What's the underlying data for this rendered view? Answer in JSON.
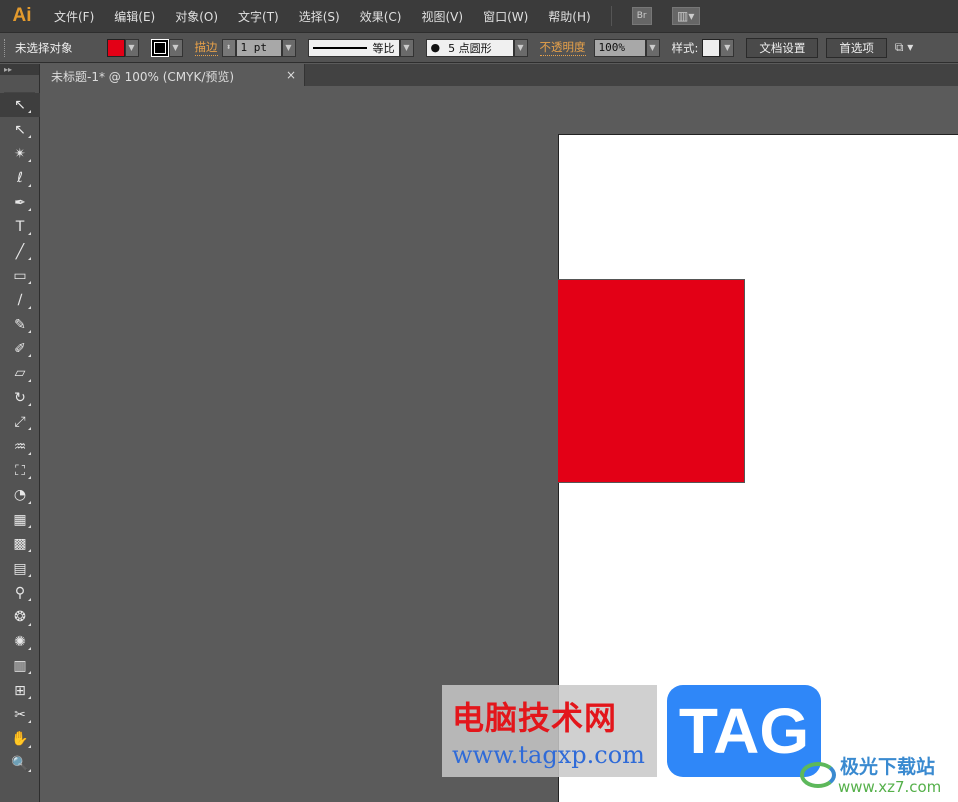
{
  "app": {
    "logo": "Ai"
  },
  "menu": [
    "文件(F)",
    "编辑(E)",
    "对象(O)",
    "文字(T)",
    "选择(S)",
    "效果(C)",
    "视图(V)",
    "窗口(W)",
    "帮助(H)"
  ],
  "menu_buttons": {
    "bridge": "Br"
  },
  "control": {
    "selection": "未选择对象",
    "fill_color": "#e30016",
    "stroke_label": "描边",
    "stroke_weight": "1 pt",
    "profile": "等比",
    "brush": "5 点圆形",
    "opacity_label": "不透明度",
    "opacity": "100%",
    "style_label": "样式:",
    "doc_setup": "文档设置",
    "preferences": "首选项"
  },
  "doc_tab": {
    "title": "未标题-1* @ 100% (CMYK/预览)",
    "close": "×"
  },
  "tools": [
    "selection",
    "direct-selection",
    "magic-wand",
    "lasso",
    "pen",
    "type",
    "line-segment",
    "rectangle",
    "paintbrush",
    "pencil",
    "blob-brush",
    "eraser",
    "rotate",
    "scale",
    "warp",
    "free-transform",
    "shape-builder",
    "perspective-grid",
    "mesh",
    "gradient",
    "eyedropper",
    "blend",
    "symbol-sprayer",
    "column-graph",
    "artboard",
    "slice",
    "hand",
    "zoom"
  ],
  "tool_glyphs": [
    "↖",
    "↖",
    "✴",
    "ℓ",
    "✒",
    "T",
    "╱",
    "▭",
    "∕",
    "✎",
    "✐",
    "▱",
    "↻",
    "⤢",
    "♒",
    "⛶",
    "◔",
    "▦",
    "▩",
    "▤",
    "⚲",
    "❂",
    "✺",
    "▥",
    "⊞",
    "✂",
    "✋",
    "🔍"
  ],
  "artwork": {
    "rect_color": "#e30016"
  },
  "watermarks": {
    "site_cn": "电脑技术网",
    "site_url": "www.tagxp.com",
    "tag": "TAG",
    "xz_name": "极光下载站",
    "xz_url": "www.xz7.com"
  }
}
